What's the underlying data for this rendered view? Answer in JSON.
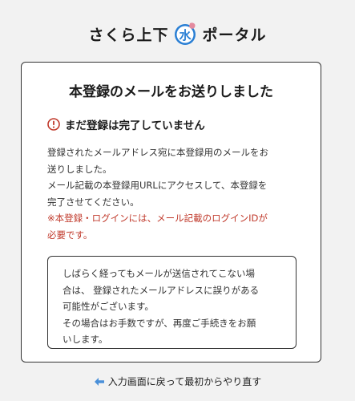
{
  "header": {
    "logo_left": "さくら上下",
    "logo_right": "ポータル",
    "logo_icon": "water-drop-logo-icon",
    "logo_glyph": "水"
  },
  "card": {
    "title": "本登録のメールをお送りしました",
    "warning_icon": "exclamation-circle-icon",
    "warning_text": "まだ登録は完了していません",
    "message_lines": [
      "登録されたメールアドレス宛に本登録用のメールをお",
      "送りしました。",
      "メール記載の本登録用URLにアクセスして、本登録を",
      "完了させてください。"
    ],
    "note_lines": [
      "※本登録・ログインには、メール記載のログインIDが",
      "必要です。"
    ],
    "notice_lines": [
      "しばらく経ってもメールが送信されてこない場",
      "合は、 登録されたメールアドレスに誤りがある",
      "可能性がございます。",
      "その場合はお手数ですが、再度ご手続きをお願",
      "いします。"
    ]
  },
  "back_link": {
    "icon": "arrow-left-icon",
    "label": "入力画面に戻って最初からやり直す"
  },
  "colors": {
    "background": "#f2f2f2",
    "card_background": "#ffffff",
    "warning_red": "#c0392b",
    "note_red": "#c0392b",
    "logo_blue": "#2a7fd4",
    "arrow_blue": "#4a90d9"
  }
}
